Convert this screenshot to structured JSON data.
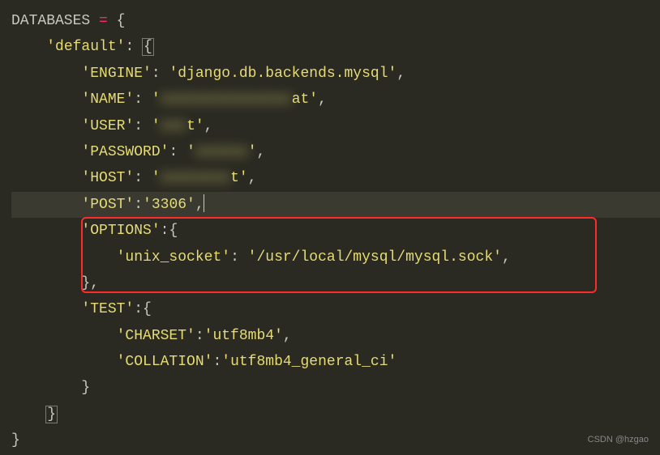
{
  "code": {
    "var_name": "DATABASES",
    "eq": " = ",
    "open_brace": "{",
    "default_key": "'default'",
    "colon": ": ",
    "colon_tight": ":",
    "open_brace2": "{",
    "engine_key": "'ENGINE'",
    "engine_val": "'django.db.backends.mysql'",
    "name_key": "'NAME'",
    "name_val_open": "'",
    "name_val_blur": "xxxxxxxxxxxxxxx",
    "name_val_suffix": "at'",
    "user_key": "'USER'",
    "user_val_open": "'",
    "user_val_blur": "xxx",
    "user_val_suffix": "t'",
    "password_key": "'PASSWORD'",
    "password_val_open": "'",
    "password_val_blur": "xxxxxx",
    "password_val_suffix": "'",
    "host_key": "'HOST'",
    "host_val_open": "'",
    "host_val_blur": "xxxxxxxx",
    "host_val_suffix": "t'",
    "post_key": "'POST'",
    "post_val": "'3306'",
    "options_key": "'OPTIONS'",
    "unix_socket_key": "'unix_socket'",
    "unix_socket_val": "'/usr/local/mysql/mysql.sock'",
    "test_key": "'TEST'",
    "charset_key": "'CHARSET'",
    "charset_val": "'utf8mb4'",
    "collation_key": "'COLLATION'",
    "collation_val": "'utf8mb4_general_ci'",
    "close_brace": "}",
    "comma": ","
  },
  "watermark": "CSDN @hzgao"
}
